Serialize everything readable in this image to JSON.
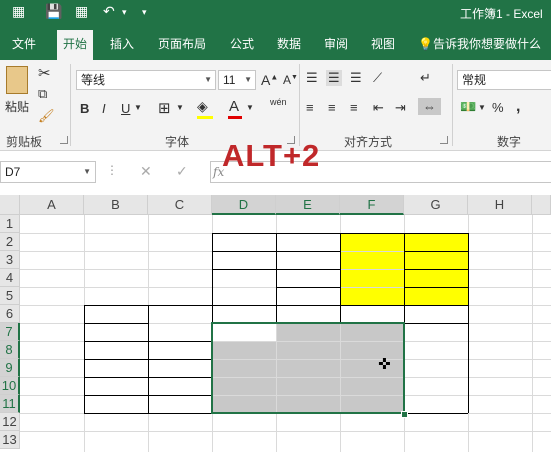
{
  "titlebar": {
    "title": "工作簿1 - Excel",
    "qa_grid": "▦",
    "qa_save": "💾",
    "qa_undo": "↶",
    "qa_more": "▾"
  },
  "tabs": [
    {
      "label": "文件",
      "active": false
    },
    {
      "label": "开始",
      "active": true
    },
    {
      "label": "插入",
      "active": false
    },
    {
      "label": "页面布局",
      "active": false
    },
    {
      "label": "公式",
      "active": false
    },
    {
      "label": "数据",
      "active": false
    },
    {
      "label": "审阅",
      "active": false
    },
    {
      "label": "视图",
      "active": false
    }
  ],
  "tell_me": "告诉我你想要做什么",
  "ribbon": {
    "clipboard": {
      "paste": "粘贴",
      "label": "剪贴板"
    },
    "font": {
      "name": "等线",
      "size": "11",
      "bold": "B",
      "italic": "I",
      "underline": "U",
      "grow": "A",
      "shrink": "A",
      "label": "字体",
      "font_color": "A",
      "wen": "wén"
    },
    "alignment": {
      "label": "对齐方式"
    },
    "number": {
      "format": "常规",
      "label": "数字",
      "percent": "%",
      "comma": ","
    }
  },
  "formula_bar": {
    "name_box": "D7",
    "cancel": "✕",
    "enter": "✓",
    "fx": "fx",
    "content": ""
  },
  "overlay_text": "ALT+2",
  "columns": [
    "A",
    "B",
    "C",
    "D",
    "E",
    "F",
    "G",
    "H"
  ],
  "rows": [
    "1",
    "2",
    "3",
    "4",
    "5",
    "6",
    "7",
    "8",
    "9",
    "10",
    "11",
    "12",
    "13"
  ],
  "colors": {
    "excel_green": "#217346",
    "yellow": "#ffff00",
    "selection_grey": "#c8c8c8",
    "overlay_red": "#c0282a"
  }
}
